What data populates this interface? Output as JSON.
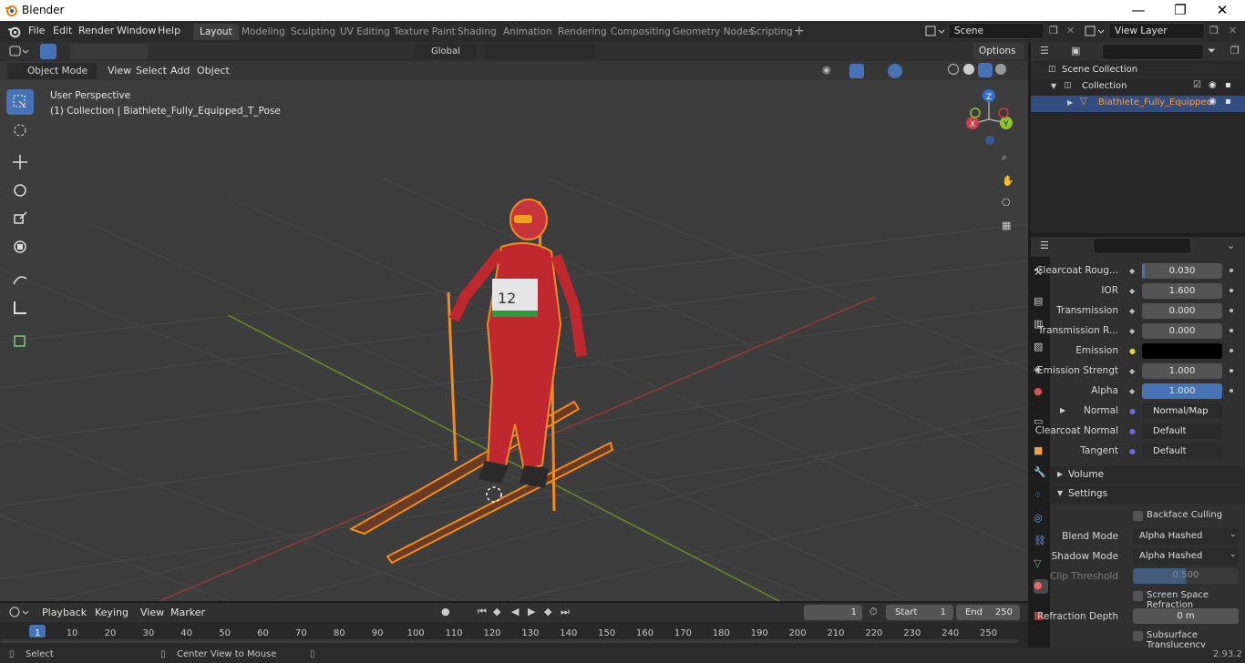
{
  "window": {
    "title": "Blender",
    "min": "—",
    "max": "❐",
    "close": "✕"
  },
  "menu": [
    "File",
    "Edit",
    "Render",
    "Window",
    "Help"
  ],
  "workspaces": [
    "Layout",
    "Modeling",
    "Sculpting",
    "UV Editing",
    "Texture Paint",
    "Shading",
    "Animation",
    "Rendering",
    "Compositing",
    "Geometry Nodes",
    "Scripting"
  ],
  "active_workspace": "Layout",
  "scene": "Scene",
  "view_layer": "View Layer",
  "viewport": {
    "mode": "Object Mode",
    "menus": [
      "View",
      "Select",
      "Add",
      "Object"
    ],
    "orientation": "Global",
    "options": "Options",
    "info_line1": "User Perspective",
    "info_line2": "(1) Collection | Biathlete_Fully_Equipped_T_Pose",
    "gizmo": {
      "z": "Z",
      "x": "X",
      "y": "Y"
    }
  },
  "outliner": {
    "root": "Scene Collection",
    "collection": "Collection",
    "object": "Biathlete_Fully_Equippec"
  },
  "properties": {
    "rows": [
      {
        "label": "Clearcoat Roug...",
        "value": "0.030",
        "fill": 0.03
      },
      {
        "label": "IOR",
        "value": "1.600"
      },
      {
        "label": "Transmission",
        "value": "0.000"
      },
      {
        "label": "Transmission R...",
        "value": "0.000"
      },
      {
        "label": "Emission",
        "value": ""
      },
      {
        "label": "Emission Strengt",
        "value": "1.000"
      },
      {
        "label": "Alpha",
        "value": "1.000",
        "fill": 1.0
      },
      {
        "label": "Normal",
        "value": "Normal/Map"
      },
      {
        "label": "Clearcoat Normal",
        "value": "Default"
      },
      {
        "label": "Tangent",
        "value": "Default"
      }
    ],
    "volume": "Volume",
    "settings": "Settings",
    "backface": "Backface Culling",
    "blend_label": "Blend Mode",
    "blend_value": "Alpha Hashed",
    "shadow_label": "Shadow Mode",
    "shadow_value": "Alpha Hashed",
    "clip_label": "Clip Threshold",
    "clip_value": "0.500",
    "screen_refraction": "Screen Space Refraction",
    "refraction_depth_label": "Refraction Depth",
    "refraction_depth_value": "0 m",
    "subsurface": "Subsurface Translucency"
  },
  "timeline": {
    "menus": [
      "Playback",
      "Keying",
      "View",
      "Marker"
    ],
    "current_frame": "1",
    "start_label": "Start",
    "start": "1",
    "end_label": "End",
    "end": "250",
    "ticks": [
      "1",
      "10",
      "20",
      "30",
      "40",
      "50",
      "60",
      "70",
      "80",
      "90",
      "100",
      "110",
      "120",
      "130",
      "140",
      "150",
      "160",
      "170",
      "180",
      "190",
      "200",
      "210",
      "220",
      "230",
      "240",
      "250"
    ]
  },
  "status": {
    "left": "Select",
    "middle": "Center View to Mouse",
    "version": "2.93.2"
  }
}
